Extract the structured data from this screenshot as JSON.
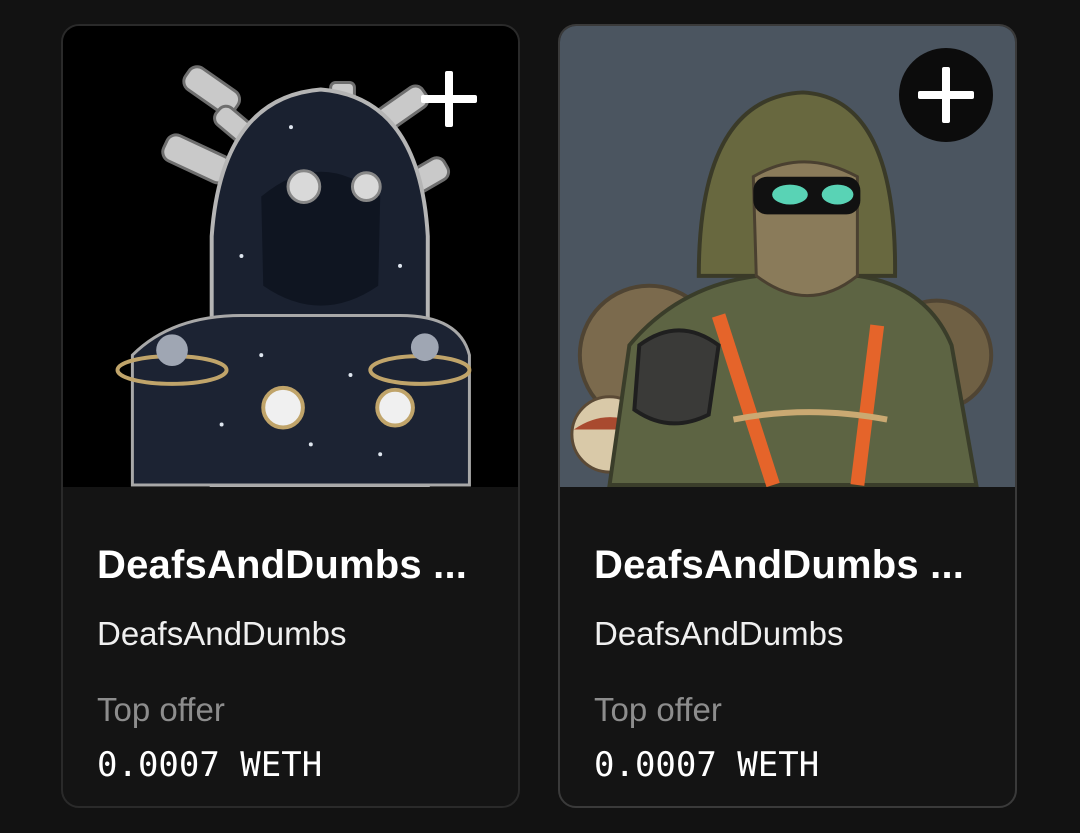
{
  "cards": [
    {
      "title": "DeafsAndDumbs ...",
      "collection": "DeafsAndDumbs",
      "offer_label": "Top offer",
      "offer_value": "0.0007 WETH",
      "image_icon": "hooded-astronomer-figure",
      "art_bg": "#000000"
    },
    {
      "title": "DeafsAndDumbs ...",
      "collection": "DeafsAndDumbs",
      "offer_label": "Top offer",
      "offer_value": "0.0007 WETH",
      "image_icon": "hooded-camouflage-figure",
      "art_bg": "#4b5560"
    }
  ],
  "add_button_icon": "plus-icon"
}
